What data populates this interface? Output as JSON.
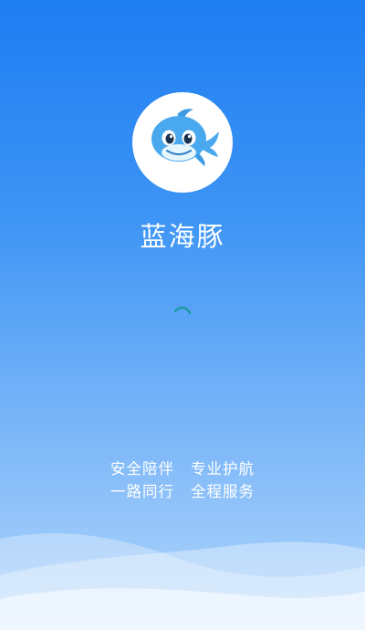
{
  "app": {
    "name": "蓝海豚",
    "logo_icon": "dolphin-logo-icon",
    "loading_icon": "loading-spinner-icon"
  },
  "slogan": {
    "line1": [
      "安全陪伴",
      "专业护航"
    ],
    "line2": [
      "一路同行",
      "全程服务"
    ]
  },
  "colors": {
    "background_top": "#1e7df2",
    "background_bottom": "#b2d6fb",
    "dolphin": "#4aa8ee",
    "spinner": "#1a9a9a"
  }
}
